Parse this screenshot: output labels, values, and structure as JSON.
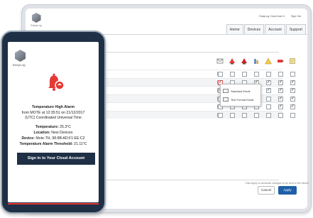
{
  "web": {
    "logo_text": "EasyLog",
    "user_link": "EasyLog Cloud User ▾",
    "signout_link": "Sign Out",
    "nav": [
      "Home",
      "Devices",
      "Account",
      "Support"
    ],
    "tab_info_glyph": "i",
    "table": {
      "header_icons": [
        "mail-icon",
        "red-alarm-icon",
        "red-alarm-icon",
        "sensor-icon",
        "warning-icon",
        "battery-icon",
        "note-icon"
      ],
      "rows": [
        {
          "text": "",
          "checks": [
            false,
            false,
            false,
            false,
            false,
            false,
            false
          ]
        },
        {
          "text": "",
          "checks": [
            true,
            false,
            false,
            true,
            true,
            true,
            true
          ]
        },
        {
          "text": "",
          "checks": [
            true,
            false,
            false,
            false,
            true,
            true,
            true
          ]
        },
        {
          "text": "",
          "checks": [
            false,
            false,
            false,
            false,
            false,
            true,
            true
          ]
        },
        {
          "text": "",
          "checks": [
            false,
            false,
            false,
            false,
            false,
            true,
            true
          ]
        },
        {
          "text": "",
          "checks": [
            false,
            false,
            false,
            false,
            false,
            false,
            false
          ]
        }
      ]
    },
    "dropdown": [
      "Standard Email",
      "Text Format Email"
    ],
    "apply_hint": "Click Apply to schedule changes to be sent to the device",
    "cancel_label": "Cancel",
    "apply_label": "Apply"
  },
  "phone": {
    "logo_text": "EasyLog",
    "alert_title": "Temperature High Alarm",
    "alert_source": "from MOTE at 12:35:51 on 21/12/2017",
    "alert_tz": "(UTC) Coordinated Universal Time",
    "details": [
      {
        "label": "Temperature:",
        "value": "25.3°C"
      },
      {
        "label": "Location:",
        "value": "New Devices"
      },
      {
        "label": "Device:",
        "value": "Mote-TH, 98:8B:AD:F1:EE:C2"
      },
      {
        "label": "Temperature Alarm Threshold:",
        "value": "21.11°C"
      }
    ],
    "signin_label": "Sign in to Your Cloud Account"
  },
  "colors": {
    "accent_red": "#e53935",
    "navy": "#1f2f45",
    "apply_blue": "#1e5fa8"
  }
}
